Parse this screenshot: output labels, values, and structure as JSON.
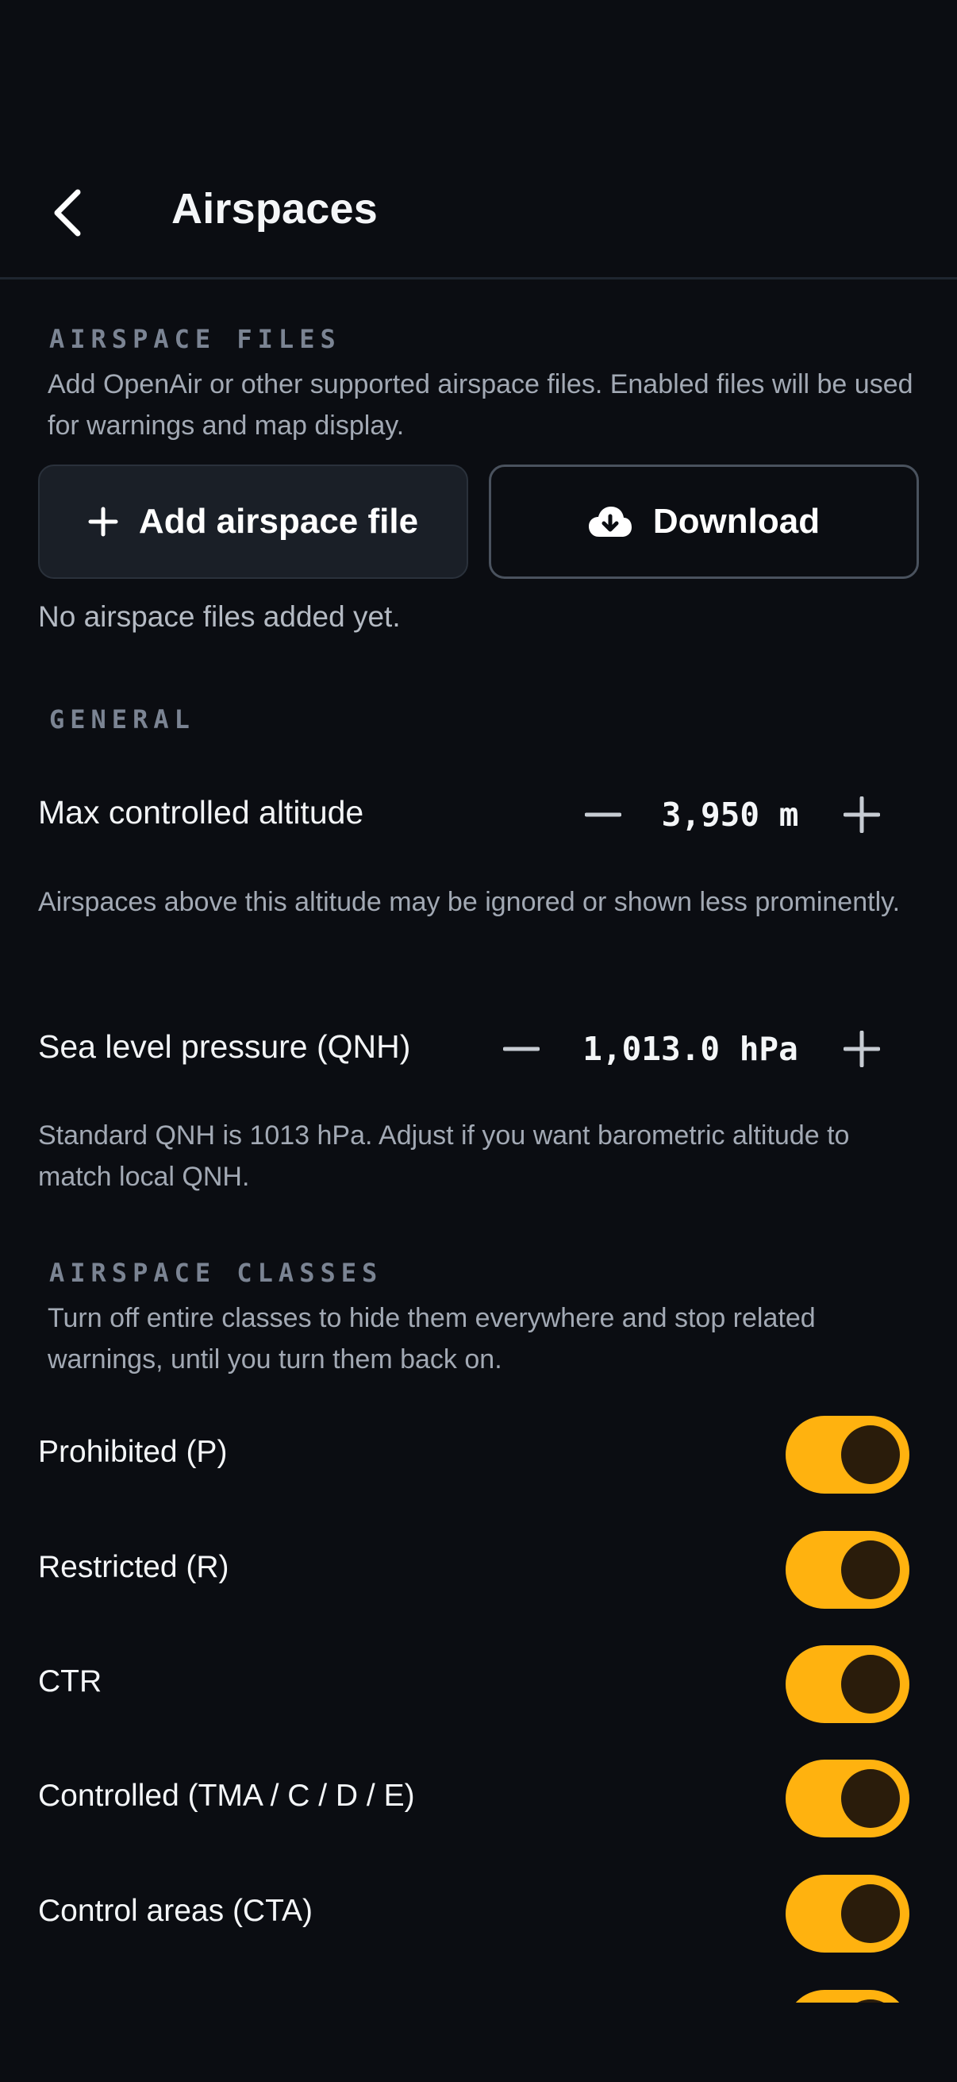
{
  "header": {
    "title": "Airspaces"
  },
  "files": {
    "section_label": "AIRSPACE FILES",
    "description": "Add OpenAir or other supported airspace files. Enabled files will be used for warnings and map display.",
    "add_button_label": "Add airspace file",
    "download_button_label": "Download",
    "empty_text": "No airspace files added yet."
  },
  "general": {
    "section_label": "GENERAL",
    "max_altitude": {
      "label": "Max controlled altitude",
      "value": "3,950 m",
      "helper": "Airspaces above this altitude may be ignored or shown less prominently."
    },
    "qnh": {
      "label": "Sea level pressure (QNH)",
      "value": "1,013.0 hPa",
      "helper": "Standard QNH is 1013 hPa. Adjust if you want barometric altitude to match local QNH."
    }
  },
  "classes": {
    "section_label": "AIRSPACE CLASSES",
    "description": "Turn off entire classes to hide them everywhere and stop related warnings, until you turn them back on.",
    "items": [
      {
        "label": "Prohibited (P)",
        "enabled": true
      },
      {
        "label": "Restricted (R)",
        "enabled": true
      },
      {
        "label": "CTR",
        "enabled": true
      },
      {
        "label": "Controlled (TMA / C / D / E)",
        "enabled": true
      },
      {
        "label": "Control areas (CTA)",
        "enabled": true
      }
    ]
  },
  "colors": {
    "background": "#0b0d12",
    "accent": "#ffb20f",
    "muted_text": "#a2a9b4",
    "section_label": "#7b8493"
  },
  "icons": {
    "back": "chevron-left-icon",
    "add": "plus-icon",
    "download": "cloud-download-icon",
    "decrement": "minus-icon",
    "increment": "plus-icon"
  }
}
